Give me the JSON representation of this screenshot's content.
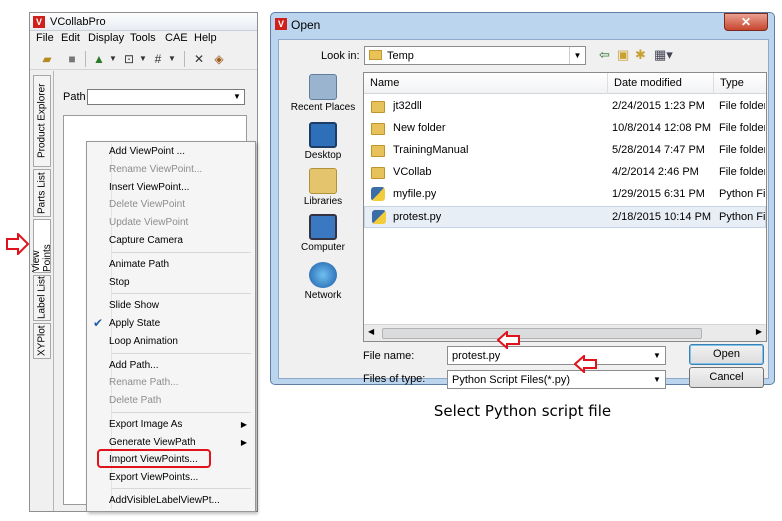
{
  "app": {
    "title": "VCollabPro",
    "logo": "V",
    "menu": [
      "File",
      "Edit",
      "Display",
      "Tools",
      "CAE",
      "Help"
    ],
    "side_tabs": [
      "Product Explorer",
      "Parts List",
      "View Points",
      "Label List",
      "XYPlot"
    ],
    "path_label": "Path"
  },
  "context_menu": {
    "items": [
      {
        "label": "Add ViewPoint ...",
        "enabled": true
      },
      {
        "label": "Rename ViewPoint...",
        "enabled": false
      },
      {
        "label": "Insert ViewPoint...",
        "enabled": true
      },
      {
        "label": "Delete ViewPoint",
        "enabled": false
      },
      {
        "label": "Update ViewPoint",
        "enabled": false
      },
      {
        "label": "Capture Camera",
        "enabled": true
      },
      {
        "label": "Animate Path",
        "enabled": true
      },
      {
        "label": "Stop",
        "enabled": true
      },
      {
        "label": "Slide Show",
        "enabled": true
      },
      {
        "label": "Apply State",
        "enabled": true,
        "checked": true
      },
      {
        "label": "Loop Animation",
        "enabled": true
      },
      {
        "label": "Add Path...",
        "enabled": true
      },
      {
        "label": "Rename Path...",
        "enabled": false
      },
      {
        "label": "Delete Path",
        "enabled": false
      },
      {
        "label": "Export Image As",
        "enabled": true,
        "submenu": true
      },
      {
        "label": "Generate ViewPath",
        "enabled": true,
        "submenu": true
      },
      {
        "label": "Import ViewPoints...",
        "enabled": true,
        "highlighted": true
      },
      {
        "label": "Export ViewPoints...",
        "enabled": true
      },
      {
        "label": "AddVisibleLabelViewPt...",
        "enabled": true
      }
    ]
  },
  "dialog": {
    "title": "Open",
    "close": "✕",
    "look_in_label": "Look in:",
    "look_in_value": "Temp",
    "places": [
      "Recent Places",
      "Desktop",
      "Libraries",
      "Computer",
      "Network"
    ],
    "columns": [
      "Name",
      "Date modified",
      "Type"
    ],
    "files": [
      {
        "name": "jt32dll",
        "date": "2/24/2015 1:23 PM",
        "type": "File folder",
        "icon": "folder"
      },
      {
        "name": "New folder",
        "date": "10/8/2014 12:08 PM",
        "type": "File folder",
        "icon": "folder"
      },
      {
        "name": "TrainingManual",
        "date": "5/28/2014 7:47 PM",
        "type": "File folder",
        "icon": "folder"
      },
      {
        "name": "VCollab",
        "date": "4/2/2014 2:46 PM",
        "type": "File folder",
        "icon": "folder"
      },
      {
        "name": "myfile.py",
        "date": "1/29/2015 6:31 PM",
        "type": "Python Fil",
        "icon": "python"
      },
      {
        "name": "protest.py",
        "date": "2/18/2015 10:14 PM",
        "type": "Python Fil",
        "icon": "python",
        "selected": true
      }
    ],
    "file_name_label": "File name:",
    "file_name_value": "protest.py",
    "file_type_label": "Files of type:",
    "file_type_value": "Python Script Files(*.py)",
    "open_label": "Open",
    "cancel_label": "Cancel"
  },
  "caption": "Select Python script file",
  "colors": {
    "highlight_red": "#e0121b",
    "dialog_frame": "#bcd5ee",
    "logo_red": "#d0201b"
  }
}
